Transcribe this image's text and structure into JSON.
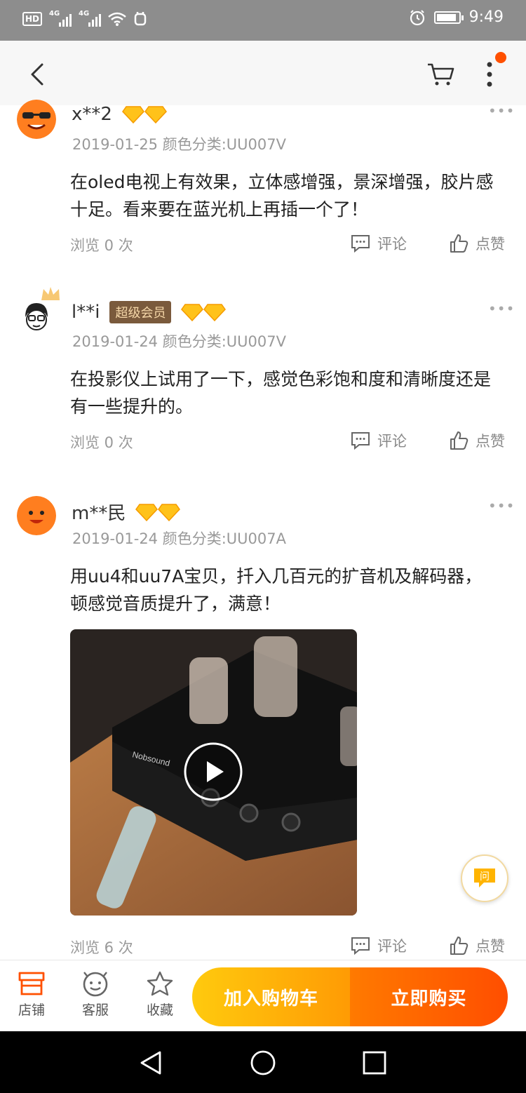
{
  "status_bar": {
    "left_label": "HD",
    "network_1": "4G",
    "network_2": "4G",
    "time": "9:49"
  },
  "header": {
    "back_icon": "chevron-left-icon",
    "cart_icon": "cart-icon",
    "more_icon": "more-vertical-icon",
    "notification_color": "#ff5000"
  },
  "reviews": [
    {
      "username": "x**2",
      "badge": "",
      "date_variant": "2019-01-25 颜色分类:UU007V",
      "content": "在oled电视上有效果，立体感增强，景深增强，胶片感十足。看来要在蓝光机上再插一个了！",
      "views": "浏览 0 次",
      "comment_label": "评论",
      "like_label": "点赞"
    },
    {
      "username": "l**i",
      "badge": "超级会员",
      "date_variant": "2019-01-24 颜色分类:UU007V",
      "content": "在投影仪上试用了一下，感觉色彩饱和度和清晰度还是有一些提升的。",
      "views": "浏览 0 次",
      "comment_label": "评论",
      "like_label": "点赞"
    },
    {
      "username": "m**民",
      "badge": "",
      "date_variant": "2019-01-24 颜色分类:UU007A",
      "content": "用uu4和uu7A宝贝，扦入几百元的扩音机及解码器，顿感觉音质提升了，满意！",
      "video_brand": "Nobsound",
      "views": "浏览 6 次",
      "comment_label": "评论",
      "like_label": "点赞"
    }
  ],
  "floating": {
    "ask_label": "问"
  },
  "bottom_bar": {
    "store_label": "店铺",
    "service_label": "客服",
    "favorite_label": "收藏",
    "add_to_cart_label": "加入购物车",
    "buy_now_label": "立即购买"
  },
  "colors": {
    "accent_orange": "#ff5000",
    "cart_button": "#ffb400",
    "badge_bg": "#7a5a3c"
  }
}
